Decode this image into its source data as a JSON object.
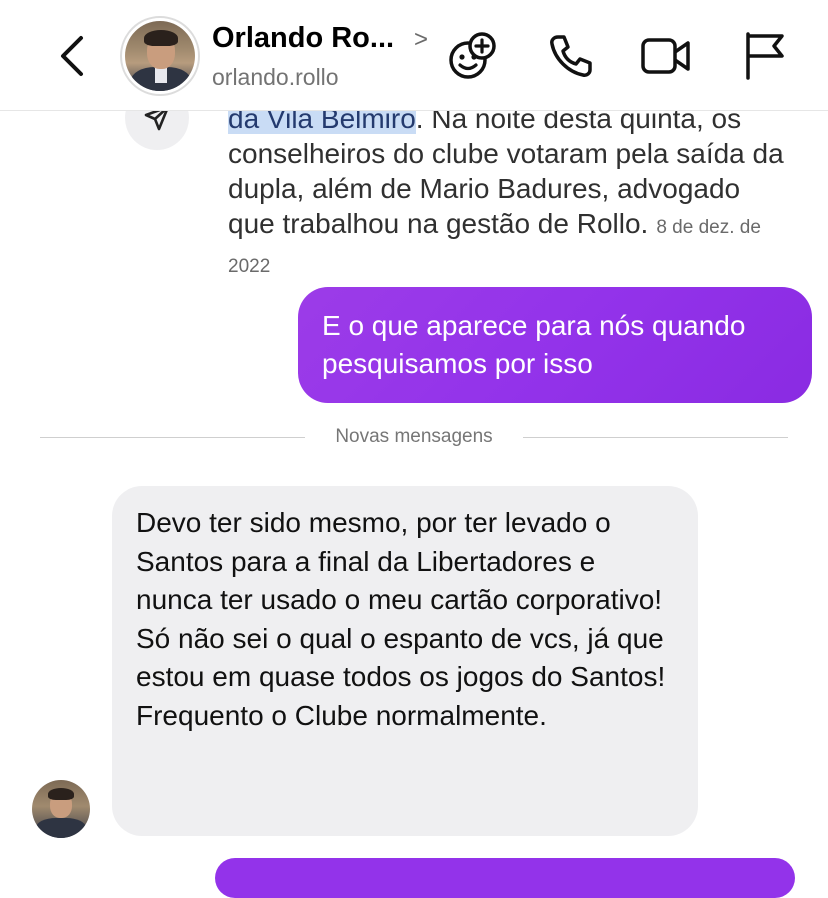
{
  "header": {
    "name": "Orlando Ro...",
    "chevron": ">",
    "handle": "orlando.rollo",
    "icons": [
      "back-icon",
      "avatar",
      "add-sticker-icon",
      "phone-icon",
      "video-icon",
      "flag-icon"
    ]
  },
  "thread": {
    "shared_post": {
      "icon": "send-icon",
      "highlighted": "da Vila Belmiro",
      "text": ". Na noite desta quinta, os conselheiros do clube votaram pela saída da dupla, além de Mario Badures, advogado que trabalhou na gestão de Rollo.",
      "date": "8 de dez. de 2022"
    },
    "outgoing_message": "E o que aparece para nós quando pesquisamos por isso",
    "divider_label": "Novas mensagens",
    "incoming_message": {
      "line1": "Devo ter sido mesmo, por ter levado o Santos para a final da Libertadores e nunca ter usado o meu cartão corporativo!",
      "line2": "Só não sei o qual o espanto de vcs, já que estou em quase todos os jogos do Santos!",
      "line3": "Frequento o Clube normalmente."
    }
  },
  "colors": {
    "accent_purple": "#9333ea",
    "incoming_bg": "#efeff1",
    "highlight": "#c9dcf5"
  }
}
